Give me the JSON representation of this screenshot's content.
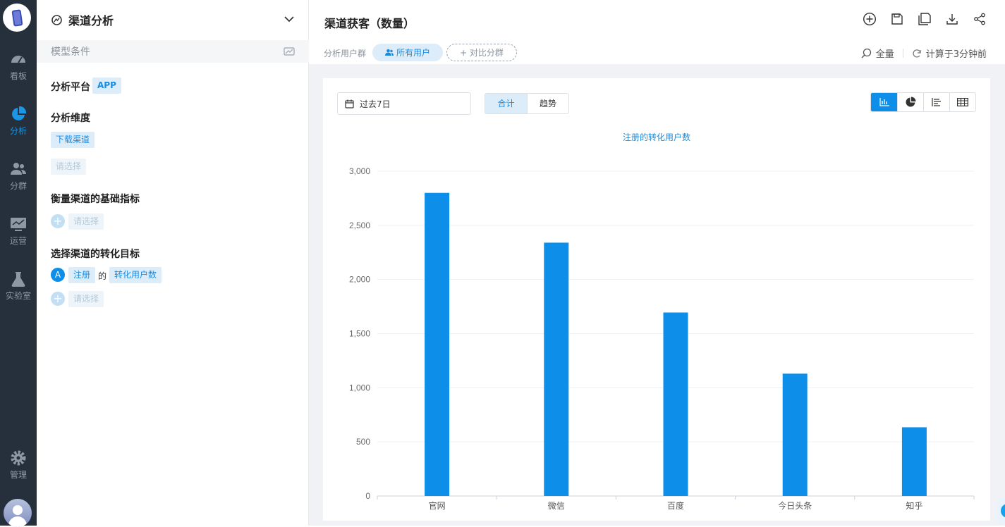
{
  "nav": {
    "items": [
      {
        "label": "看板",
        "icon": "dashboard-icon"
      },
      {
        "label": "分析",
        "icon": "pie-chart-icon"
      },
      {
        "label": "分群",
        "icon": "users-icon"
      },
      {
        "label": "运营",
        "icon": "monitor-icon"
      },
      {
        "label": "实验室",
        "icon": "flask-icon"
      }
    ],
    "manage_label": "管理"
  },
  "panel": {
    "title": "渠道分析",
    "model_conditions": "模型条件",
    "platform_title": "分析平台",
    "platform_value": "APP",
    "dimension_title": "分析维度",
    "dimension_value": "下载渠道",
    "dimension_placeholder": "请选择",
    "metric_title": "衡量渠道的基础指标",
    "metric_placeholder": "请选择",
    "goal_title": "选择渠道的转化目标",
    "goal_badge": "A",
    "goal_event": "注册",
    "goal_connector": "的",
    "goal_metric": "转化用户数",
    "goal_placeholder": "请选择"
  },
  "main": {
    "title": "渠道获客（数量）",
    "segment_label": "分析用户群",
    "segment_all": "所有用户",
    "segment_compare": "+ 对比分群",
    "sampling": "全量",
    "computed": "计算于3分钟前",
    "date_range": "过去7日",
    "toggle_total": "合计",
    "toggle_trend": "趋势"
  },
  "chart_data": {
    "type": "bar",
    "title": "注册的转化用户数",
    "categories": [
      "官网",
      "微信",
      "百度",
      "今日头条",
      "知乎"
    ],
    "values": [
      2800,
      2340,
      1695,
      1130,
      635
    ],
    "ylim": [
      0,
      3000
    ],
    "yticks": [
      0,
      500,
      1000,
      1500,
      2000,
      2500,
      3000
    ],
    "ytick_labels": [
      "0",
      "500",
      "1,000",
      "1,500",
      "2,000",
      "2,500",
      "3,000"
    ],
    "xlabel": "",
    "ylabel": "",
    "grid": true,
    "bar_color": "#0d8ee8"
  }
}
